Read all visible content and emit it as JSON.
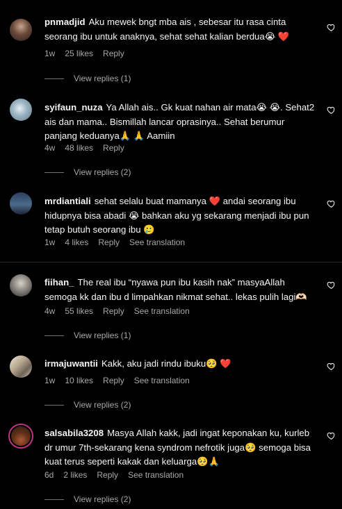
{
  "comments": [
    {
      "username": "pnmadjid",
      "text": "Aku mewek bngt mba ais , sebesar itu rasa cinta seorang ibu untuk anaknya, sehat sehat kalian berdua😭 ❤️",
      "time": "1w",
      "likes": "25 likes",
      "reply": "Reply",
      "replies": "View replies (1)"
    },
    {
      "username": "syifaun_nuza",
      "text": "Ya Allah ais.. Gk kuat nahan air mata😭 😭. Sehat2 ais dan mama.. Bismillah lancar oprasinya.. Sehat berumur panjang keduanya🙏 🙏 Aamiin",
      "time": "4w",
      "likes": "48 likes",
      "reply": "Reply",
      "replies": "View replies (2)"
    },
    {
      "username": "mrdiantiali",
      "text": "sehat selalu buat mamanya ❤️ andai seorang ibu hidupnya bisa abadi 😭 bahkan aku yg sekarang menjadi ibu pun tetap butuh seorang ibu 🥲",
      "time": "1w",
      "likes": "4 likes",
      "reply": "Reply",
      "translate": "See translation"
    },
    {
      "username": "fiihan_",
      "text": "The real ibu “nyawa pun ibu kasih nak” masyaAllah semoga kk dan ibu d limpahkan nikmat sehat.. lekas pulih lagi🫶🏻",
      "time": "4w",
      "likes": "55 likes",
      "reply": "Reply",
      "translate": "See translation",
      "replies": "View replies (1)"
    },
    {
      "username": "irmajuwantii",
      "text": "Kakk, aku jadi rindu ibuku🥺 ❤️",
      "time": "1w",
      "likes": "10 likes",
      "reply": "Reply",
      "translate": "See translation",
      "replies": "View replies (2)"
    },
    {
      "username": "salsabila3208",
      "text": "Masya Allah kakk, jadi ingat keponakan ku, kurleb dr umur 7th-sekarang kena syndrom nefrotik juga🥺 semoga bisa kuat terus seperti kakak dan keluarga🥺🙏",
      "time": "6d",
      "likes": "2 likes",
      "reply": "Reply",
      "translate": "See translation",
      "replies": "View replies (2)"
    }
  ],
  "icons": {
    "like": "heart-outline-icon"
  },
  "colors": {
    "background": "#000000",
    "text": "#f5f5f5",
    "secondary": "#a8a8a8",
    "story_ring": "#c13584"
  }
}
